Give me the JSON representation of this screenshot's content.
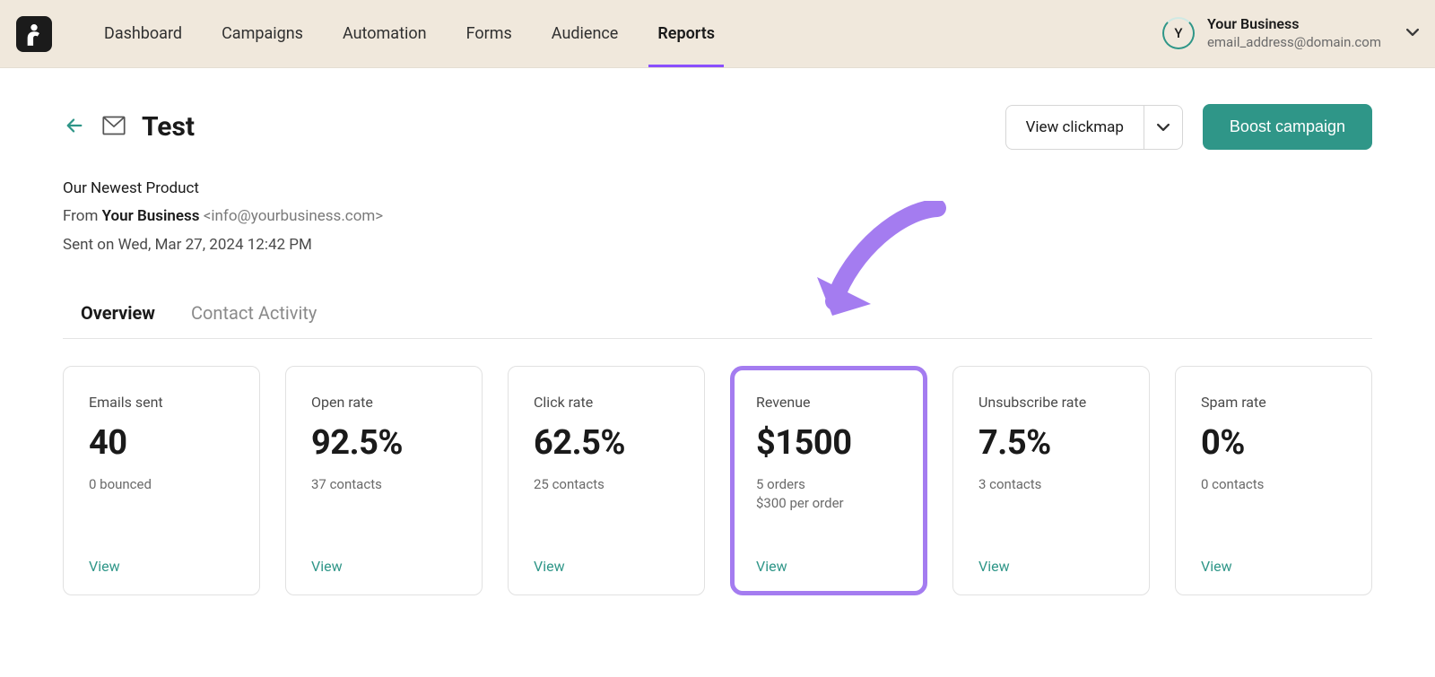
{
  "nav": {
    "items": [
      {
        "label": "Dashboard"
      },
      {
        "label": "Campaigns"
      },
      {
        "label": "Automation"
      },
      {
        "label": "Forms"
      },
      {
        "label": "Audience"
      },
      {
        "label": "Reports"
      }
    ],
    "active_index": 5
  },
  "account": {
    "initial": "Y",
    "name": "Your Business",
    "email": "email_address@domain.com"
  },
  "page": {
    "title": "Test",
    "subject": "Our Newest Product",
    "from_prefix": "From ",
    "from_name": "Your Business",
    "from_email": "<info@yourbusiness.com>",
    "sent_line": "Sent on Wed, Mar 27, 2024 12:42 PM",
    "view_clickmap": "View clickmap",
    "boost": "Boost campaign"
  },
  "tabs": [
    {
      "label": "Overview"
    },
    {
      "label": "Contact Activity"
    }
  ],
  "tabs_active_index": 0,
  "cards": [
    {
      "label": "Emails sent",
      "value": "40",
      "sub1": "0 bounced",
      "sub2": "",
      "view": "View"
    },
    {
      "label": "Open rate",
      "value": "92.5%",
      "sub1": "37 contacts",
      "sub2": "",
      "view": "View"
    },
    {
      "label": "Click rate",
      "value": "62.5%",
      "sub1": "25 contacts",
      "sub2": "",
      "view": "View"
    },
    {
      "label": "Revenue",
      "value": "$1500",
      "sub1": "5 orders",
      "sub2": "$300 per order",
      "view": "View"
    },
    {
      "label": "Unsubscribe rate",
      "value": "7.5%",
      "sub1": "3 contacts",
      "sub2": "",
      "view": "View"
    },
    {
      "label": "Spam rate",
      "value": "0%",
      "sub1": "0 contacts",
      "sub2": "",
      "view": "View"
    }
  ],
  "highlight_card_index": 3
}
